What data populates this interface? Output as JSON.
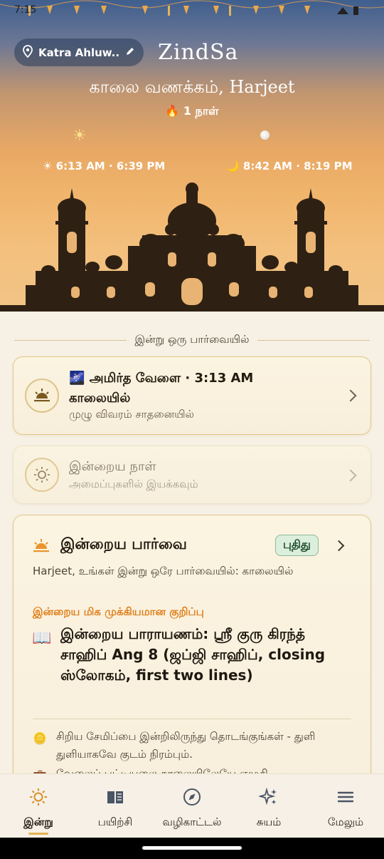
{
  "status": {
    "time": "7:15"
  },
  "header": {
    "location": "Katra Ahluw...",
    "brand": "ZindSa",
    "greeting": "காலை வணக்கம், Harjeet",
    "streak": "🔥 1 நாள்",
    "sun_times": "☀ 6:13 AM · 6:39 PM",
    "moon_times": "🌙 8:42 AM · 8:19 PM"
  },
  "section": {
    "heading": "இன்று ஒரு பார்வையில்"
  },
  "amrit_card": {
    "title": "🌌 அமிர்த வேளை · 3:13 AM காலையில்",
    "subtitle": "முழு விவரம் சாதனையில்"
  },
  "day_card": {
    "title": "இன்றைய நாள்",
    "subtitle": "அமைப்புகளில் இயக்கவும்"
  },
  "overview_card": {
    "title": "இன்றைய பார்வை",
    "badge": "புதிது",
    "intro": "Harjeet, உங்கள் இன்று ஒரே பார்வையில்: காலையில்",
    "highlight_label": "இன்றைய மிக முக்கியமான குறிப்பு",
    "highlight": "இன்றைய பாராயணம்: ஸ்ரீ குரு கிரந்த் சாஹிப் Ang 8 (ஜப்ஜி சாஹிப், closing ஸ்லோகம், first two lines)",
    "tips": [
      {
        "icon": "🪙",
        "text": "சிறிய சேமிப்பை இன்றிலிருந்து தொடங்குங்கள் - துளி துளியாகவே குடம் நிரம்பும்."
      },
      {
        "icon": "💼",
        "text": "வேலைப் பட்டியலை காலையிலேயே எழுதி"
      }
    ]
  },
  "nav": {
    "items": [
      {
        "label": "இன்று"
      },
      {
        "label": "பயிற்சி"
      },
      {
        "label": "வழிகாட்டல்"
      },
      {
        "label": "சுயம்"
      },
      {
        "label": "மேலும்"
      }
    ]
  },
  "colors": {
    "accent": "#e07d18",
    "badge_bg": "#dcefdc",
    "card_border": "#e1c887"
  }
}
